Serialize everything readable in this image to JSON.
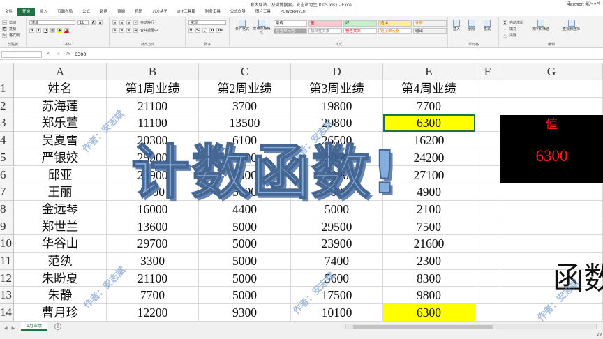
{
  "window": {
    "title": "教大网站、及微博搜索，安志斌为生0005.xlsx - Excel",
    "account": "Microsoft 帐户 ▾"
  },
  "tabs": [
    "文件",
    "开始",
    "插入",
    "页面布局",
    "公式",
    "数据",
    "审阅",
    "视图",
    "方方格子",
    "DIY工具箱",
    "财务工具",
    "公式向导",
    "图片工具",
    "POWERPIVOT"
  ],
  "active_tab": "开始",
  "ribbon": {
    "clipboard": {
      "cut": "剪切",
      "copy": "复制",
      "painter": "格式刷",
      "paste": "粘贴",
      "label": "剪贴板"
    },
    "font": {
      "name": "宋体",
      "size": "11",
      "label": "字体"
    },
    "alignment": {
      "wrap": "自动换行",
      "merge": "合并后居中",
      "label": "对齐方式"
    },
    "number": {
      "format": "常规",
      "label": "数字"
    },
    "styles": {
      "conditional": "条件格式",
      "table": "套用表格格式",
      "cells": [
        {
          "text": "常规",
          "bg": "#ffffff",
          "color": "#000000"
        },
        {
          "text": "差",
          "bg": "#ffc7ce",
          "color": "#9c0006"
        },
        {
          "text": "好",
          "bg": "#c6efce",
          "color": "#006100"
        },
        {
          "text": "适中",
          "bg": "#ffeb9c",
          "color": "#9c5700"
        },
        {
          "text": "计算",
          "bg": "#f2f2f2",
          "color": "#fa7d00"
        },
        {
          "text": "检查单元格",
          "bg": "#a5a5a5",
          "color": "#ffffff"
        },
        {
          "text": "解释性文本",
          "bg": "#ffffff",
          "color": "#7f7f7f"
        },
        {
          "text": "警告文本",
          "bg": "#ffffff",
          "color": "#ff0000"
        },
        {
          "text": "链接单元格",
          "bg": "#ffffff",
          "color": "#fa7d00"
        },
        {
          "text": "输出",
          "bg": "#f2f2f2",
          "color": "#3f3f3f"
        }
      ],
      "label": "样式"
    },
    "cells_group": {
      "insert": "插入",
      "delete": "删除",
      "format": "格式",
      "label": "单元格"
    },
    "editing": {
      "autosum": "自动求和",
      "fill": "填充",
      "clear": "清除",
      "sort": "排序和筛选",
      "find": "查找和选择",
      "label": "编辑"
    }
  },
  "formula_bar": {
    "cell_ref": "",
    "value": "6300"
  },
  "columns": [
    "A",
    "B",
    "C",
    "D",
    "E",
    "F",
    "G"
  ],
  "row_numbers": [
    "1",
    "2",
    "3",
    "4",
    "5",
    "6",
    "7",
    "8",
    "9",
    "10",
    "11",
    "12",
    "13",
    "14"
  ],
  "rows": [
    [
      "姓名",
      "第1周业绩",
      "第2周业绩",
      "第3周业绩",
      "第4周业绩"
    ],
    [
      "苏海莲",
      "21100",
      "3700",
      "19800",
      "7700"
    ],
    [
      "郑乐萱",
      "11100",
      "13500",
      "29800",
      "6300"
    ],
    [
      "吴夏雪",
      "20300",
      "6100",
      "26500",
      "16200"
    ],
    [
      "严银姣",
      "25900",
      "5000",
      "5000",
      "24200"
    ],
    [
      "邱亚",
      "25900",
      "5000",
      "5000",
      "27100"
    ],
    [
      "王丽",
      "3100",
      "5000",
      "5000",
      "4900"
    ],
    [
      "金远琴",
      "16000",
      "4400",
      "5000",
      "2100"
    ],
    [
      "郑世兰",
      "13600",
      "5000",
      "29500",
      "7500"
    ],
    [
      "华谷山",
      "29700",
      "5000",
      "23900",
      "21600"
    ],
    [
      "范纨",
      "3300",
      "5000",
      "7400",
      "2300"
    ],
    [
      "朱盼夏",
      "21100",
      "5000",
      "5600",
      "8300"
    ],
    [
      "朱静",
      "7700",
      "5000",
      "17500",
      "9800"
    ],
    [
      "曹月珍",
      "12200",
      "9300",
      "10100",
      "6300"
    ]
  ],
  "value_box": {
    "label": "值",
    "value": "6300"
  },
  "big_text": "函数",
  "overlay_title": "计数函数!",
  "watermark": "作者：安志斌",
  "sheet_tab": "1月业绩",
  "zoom": "29"
}
